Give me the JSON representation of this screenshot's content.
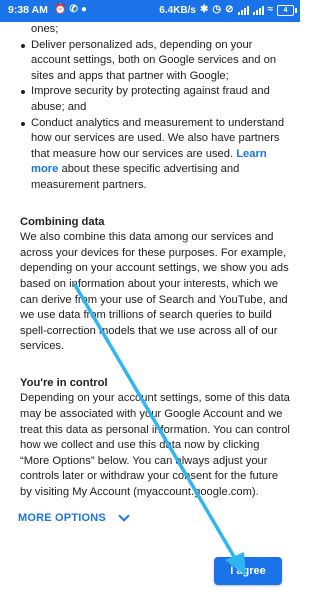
{
  "status_bar": {
    "time": "9:38 AM",
    "network_speed": "6.4KB/s",
    "battery_level": "4",
    "icons": [
      "alarm-icon",
      "whatsapp-icon",
      "bluetooth-icon",
      "alarm-clock-icon",
      "mute-icon",
      "signal-icon",
      "wifi-icon",
      "battery-icon"
    ]
  },
  "content": {
    "bullets": [
      {
        "text": "ones;",
        "continuation": true
      },
      {
        "text": "Deliver personalized ads, depending on your account settings, both on Google services and on sites and apps that partner with Google;"
      },
      {
        "text": "Improve security by protecting against fraud and abuse; and"
      },
      {
        "text": "Conduct analytics and measurement to understand how our services are used. We also have partners that measure how our services are used.",
        "link": "Learn more",
        "after_link": "about these specific advertising and measurement partners."
      }
    ],
    "sections": [
      {
        "heading": "Combining data",
        "body": "We also combine this data among our services and across your devices for these purposes. For example, depending on your account settings, we show you ads based on information about your interests, which we can derive from your use of Search and YouTube, and we use data from trillions of search queries to build spell-correction models that we use across all of our services."
      },
      {
        "heading": "You're in control",
        "body": "Depending on your account settings, some of this data may be associated with your Google Account and we treat this data as personal information. You can control how we collect and use this data now by clicking “More Options” below. You can always adjust your controls later or withdraw your consent for the future by visiting My Account (myaccount.google.com)."
      }
    ]
  },
  "footer": {
    "more_options_label": "MORE OPTIONS",
    "agree_label": "I agree"
  },
  "colors": {
    "accent": "#1a73e8",
    "annotation_arrow": "#2fb6f0",
    "text": "#202124"
  }
}
